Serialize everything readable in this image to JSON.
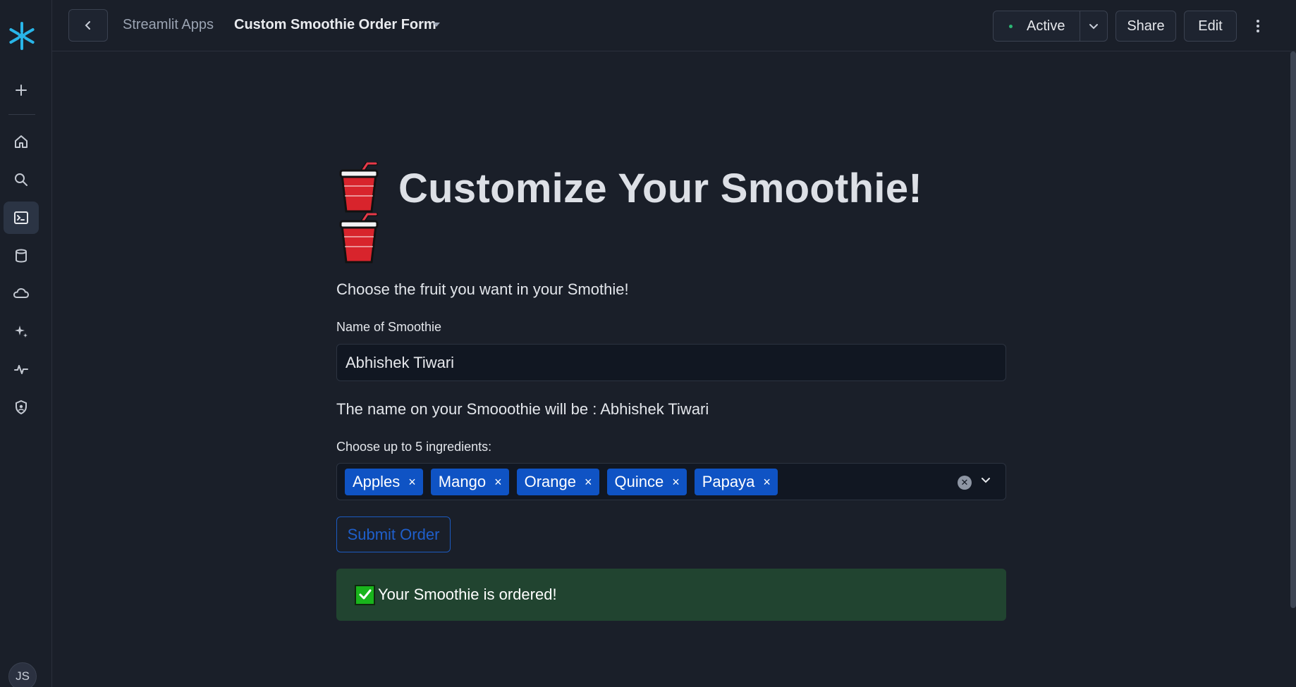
{
  "topbar": {
    "breadcrumb_app": "Streamlit Apps",
    "breadcrumb_title": "Custom Smoothie Order Form",
    "status_label": "Active",
    "share_label": "Share",
    "edit_label": "Edit"
  },
  "rail": {
    "icons": [
      "snowflake-logo",
      "plus-icon",
      "home-icon",
      "search-icon",
      "terminal-icon",
      "database-icon",
      "cloud-icon",
      "sparkle-icon",
      "activity-icon",
      "shield-icon"
    ],
    "avatar_initials": "JS"
  },
  "main": {
    "title": "Customize Your Smoothie!",
    "subtitle": "Choose the fruit you want in your Smothie!",
    "name_label": "Name of Smoothie",
    "name_value": "Abhishek Tiwari",
    "confirm_text": "The name on your Smooothie will be : Abhishek Tiwari",
    "ingredients_label": "Choose up to 5 ingredients:",
    "ingredients": [
      "Apples",
      "Mango",
      "Orange",
      "Quince",
      "Papaya"
    ],
    "remove_glyph": "×",
    "submit_label": "Submit Order",
    "success_text": "Your Smoothie is ordered!"
  },
  "colors": {
    "background": "#1a1f29",
    "chip": "#0f53c4",
    "success_bg": "#214430",
    "status_dot": "#2bb673"
  }
}
